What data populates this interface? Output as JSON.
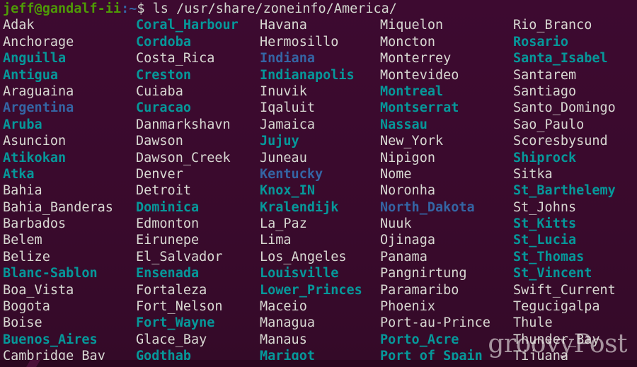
{
  "terminal": {
    "background_color": "#3b0a2e",
    "prompt": {
      "user_host": "jeff@gandalf-ii",
      "separator": ":",
      "path": "~",
      "sigil": "$",
      "command": " ls /usr/share/zoneinfo/America/"
    },
    "colors": {
      "user": "#4e9a06",
      "punct": "#3465a4",
      "file": "#d8d8d2",
      "symlink": "#06989a",
      "directory": "#3465a4"
    },
    "watermark": "groovyPost",
    "columns": 5,
    "rows": 21,
    "entries": [
      [
        {
          "name": "Adak",
          "type": "file"
        },
        {
          "name": "Coral_Harbour",
          "type": "link"
        },
        {
          "name": "Havana",
          "type": "file"
        },
        {
          "name": "Miquelon",
          "type": "file"
        },
        {
          "name": "Rio_Branco",
          "type": "file"
        }
      ],
      [
        {
          "name": "Anchorage",
          "type": "file"
        },
        {
          "name": "Cordoba",
          "type": "link"
        },
        {
          "name": "Hermosillo",
          "type": "file"
        },
        {
          "name": "Moncton",
          "type": "file"
        },
        {
          "name": "Rosario",
          "type": "link"
        }
      ],
      [
        {
          "name": "Anguilla",
          "type": "link"
        },
        {
          "name": "Costa_Rica",
          "type": "file"
        },
        {
          "name": "Indiana",
          "type": "dir"
        },
        {
          "name": "Monterrey",
          "type": "file"
        },
        {
          "name": "Santa_Isabel",
          "type": "link"
        }
      ],
      [
        {
          "name": "Antigua",
          "type": "link"
        },
        {
          "name": "Creston",
          "type": "link"
        },
        {
          "name": "Indianapolis",
          "type": "link"
        },
        {
          "name": "Montevideo",
          "type": "file"
        },
        {
          "name": "Santarem",
          "type": "file"
        }
      ],
      [
        {
          "name": "Araguaina",
          "type": "file"
        },
        {
          "name": "Cuiaba",
          "type": "file"
        },
        {
          "name": "Inuvik",
          "type": "file"
        },
        {
          "name": "Montreal",
          "type": "link"
        },
        {
          "name": "Santiago",
          "type": "file"
        }
      ],
      [
        {
          "name": "Argentina",
          "type": "dir"
        },
        {
          "name": "Curacao",
          "type": "link"
        },
        {
          "name": "Iqaluit",
          "type": "file"
        },
        {
          "name": "Montserrat",
          "type": "link"
        },
        {
          "name": "Santo_Domingo",
          "type": "file"
        }
      ],
      [
        {
          "name": "Aruba",
          "type": "link"
        },
        {
          "name": "Danmarkshavn",
          "type": "file"
        },
        {
          "name": "Jamaica",
          "type": "file"
        },
        {
          "name": "Nassau",
          "type": "link"
        },
        {
          "name": "Sao_Paulo",
          "type": "file"
        }
      ],
      [
        {
          "name": "Asuncion",
          "type": "file"
        },
        {
          "name": "Dawson",
          "type": "file"
        },
        {
          "name": "Jujuy",
          "type": "link"
        },
        {
          "name": "New_York",
          "type": "file"
        },
        {
          "name": "Scoresbysund",
          "type": "file"
        }
      ],
      [
        {
          "name": "Atikokan",
          "type": "link"
        },
        {
          "name": "Dawson_Creek",
          "type": "file"
        },
        {
          "name": "Juneau",
          "type": "file"
        },
        {
          "name": "Nipigon",
          "type": "file"
        },
        {
          "name": "Shiprock",
          "type": "link"
        }
      ],
      [
        {
          "name": "Atka",
          "type": "link"
        },
        {
          "name": "Denver",
          "type": "file"
        },
        {
          "name": "Kentucky",
          "type": "dir"
        },
        {
          "name": "Nome",
          "type": "file"
        },
        {
          "name": "Sitka",
          "type": "file"
        }
      ],
      [
        {
          "name": "Bahia",
          "type": "file"
        },
        {
          "name": "Detroit",
          "type": "file"
        },
        {
          "name": "Knox_IN",
          "type": "link"
        },
        {
          "name": "Noronha",
          "type": "file"
        },
        {
          "name": "St_Barthelemy",
          "type": "link"
        }
      ],
      [
        {
          "name": "Bahia_Banderas",
          "type": "file"
        },
        {
          "name": "Dominica",
          "type": "link"
        },
        {
          "name": "Kralendijk",
          "type": "link"
        },
        {
          "name": "North_Dakota",
          "type": "dir"
        },
        {
          "name": "St_Johns",
          "type": "file"
        }
      ],
      [
        {
          "name": "Barbados",
          "type": "file"
        },
        {
          "name": "Edmonton",
          "type": "file"
        },
        {
          "name": "La_Paz",
          "type": "file"
        },
        {
          "name": "Nuuk",
          "type": "file"
        },
        {
          "name": "St_Kitts",
          "type": "link"
        }
      ],
      [
        {
          "name": "Belem",
          "type": "file"
        },
        {
          "name": "Eirunepe",
          "type": "file"
        },
        {
          "name": "Lima",
          "type": "file"
        },
        {
          "name": "Ojinaga",
          "type": "file"
        },
        {
          "name": "St_Lucia",
          "type": "link"
        }
      ],
      [
        {
          "name": "Belize",
          "type": "file"
        },
        {
          "name": "El_Salvador",
          "type": "file"
        },
        {
          "name": "Los_Angeles",
          "type": "file"
        },
        {
          "name": "Panama",
          "type": "file"
        },
        {
          "name": "St_Thomas",
          "type": "link"
        }
      ],
      [
        {
          "name": "Blanc-Sablon",
          "type": "link"
        },
        {
          "name": "Ensenada",
          "type": "link"
        },
        {
          "name": "Louisville",
          "type": "link"
        },
        {
          "name": "Pangnirtung",
          "type": "file"
        },
        {
          "name": "St_Vincent",
          "type": "link"
        }
      ],
      [
        {
          "name": "Boa_Vista",
          "type": "file"
        },
        {
          "name": "Fortaleza",
          "type": "file"
        },
        {
          "name": "Lower_Princes",
          "type": "link"
        },
        {
          "name": "Paramaribo",
          "type": "file"
        },
        {
          "name": "Swift_Current",
          "type": "file"
        }
      ],
      [
        {
          "name": "Bogota",
          "type": "file"
        },
        {
          "name": "Fort_Nelson",
          "type": "file"
        },
        {
          "name": "Maceio",
          "type": "file"
        },
        {
          "name": "Phoenix",
          "type": "file"
        },
        {
          "name": "Tegucigalpa",
          "type": "file"
        }
      ],
      [
        {
          "name": "Boise",
          "type": "file"
        },
        {
          "name": "Fort_Wayne",
          "type": "link"
        },
        {
          "name": "Managua",
          "type": "file"
        },
        {
          "name": "Port-au-Prince",
          "type": "file"
        },
        {
          "name": "Thule",
          "type": "file"
        }
      ],
      [
        {
          "name": "Buenos_Aires",
          "type": "link"
        },
        {
          "name": "Glace_Bay",
          "type": "file"
        },
        {
          "name": "Manaus",
          "type": "file"
        },
        {
          "name": "Porto_Acre",
          "type": "link"
        },
        {
          "name": "Thunder_Bay",
          "type": "file"
        }
      ],
      [
        {
          "name": "Cambridge_Bay",
          "type": "file"
        },
        {
          "name": "Godthab",
          "type": "link"
        },
        {
          "name": "Marigot",
          "type": "link"
        },
        {
          "name": "Port_of_Spain",
          "type": "link"
        },
        {
          "name": "Tijuana",
          "type": "file"
        }
      ]
    ]
  }
}
